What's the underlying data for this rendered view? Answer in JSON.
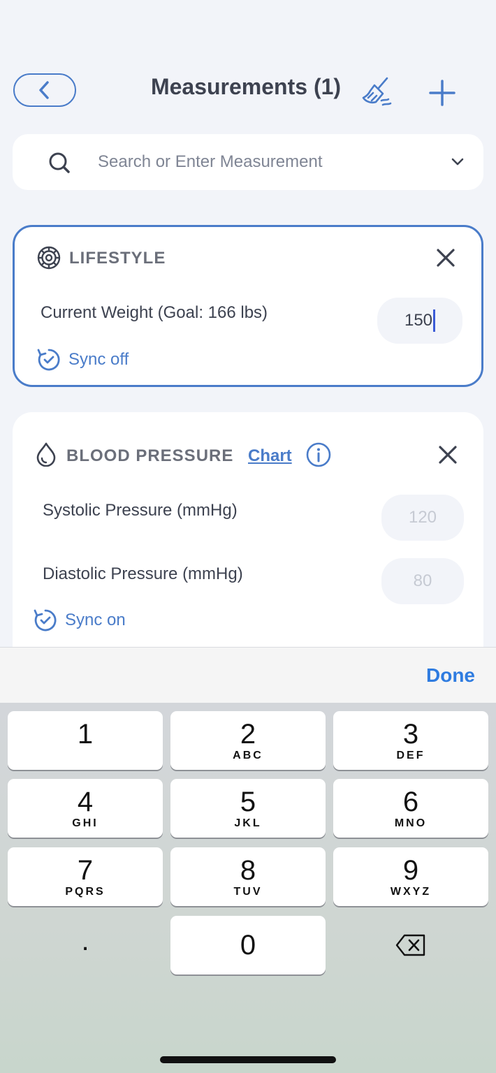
{
  "header": {
    "title": "Measurements (1)",
    "back_icon": "chevron-left-icon",
    "clean_icon": "broom-icon",
    "add_icon": "plus-icon"
  },
  "search": {
    "placeholder": "Search or Enter Measurement",
    "icon": "search-icon",
    "dropdown_icon": "chevron-down-icon"
  },
  "lifestyle": {
    "title": "LIFESTYLE",
    "icon": "lifestyle-icon",
    "row_label": "Current Weight (Goal: 166 lbs)",
    "value": "150",
    "sync_label": "Sync off"
  },
  "blood_pressure": {
    "title": "BLOOD PRESSURE",
    "chart_link": "Chart",
    "icon": "drop-icon",
    "systolic_label": "Systolic Pressure (mmHg)",
    "systolic_placeholder": "120",
    "diastolic_label": "Diastolic Pressure (mmHg)",
    "diastolic_placeholder": "80",
    "sync_label": "Sync on"
  },
  "keyboard": {
    "done": "Done",
    "keys": [
      {
        "num": "1",
        "letters": ""
      },
      {
        "num": "2",
        "letters": "ABC"
      },
      {
        "num": "3",
        "letters": "DEF"
      },
      {
        "num": "4",
        "letters": "GHI"
      },
      {
        "num": "5",
        "letters": "JKL"
      },
      {
        "num": "6",
        "letters": "MNO"
      },
      {
        "num": "7",
        "letters": "PQRS"
      },
      {
        "num": "8",
        "letters": "TUV"
      },
      {
        "num": "9",
        "letters": "WXYZ"
      },
      {
        "num": "0",
        "letters": ""
      }
    ],
    "decimal": "."
  },
  "colors": {
    "accent": "#4a7cc9",
    "done": "#2f7ce0",
    "text": "#3d4250",
    "background": "#f2f4f9"
  }
}
